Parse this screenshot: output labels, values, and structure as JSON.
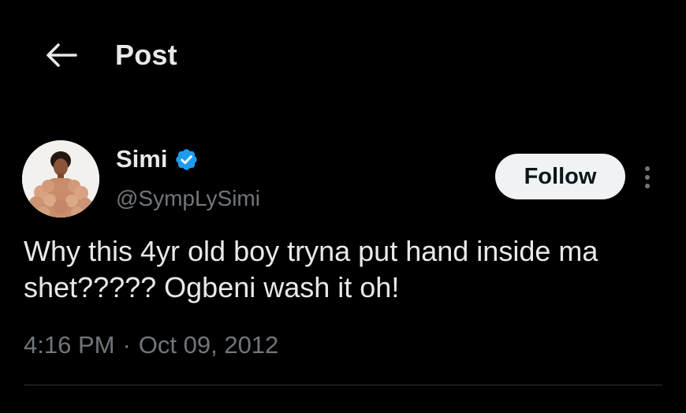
{
  "header": {
    "title": "Post",
    "back_icon": "arrow-left-icon"
  },
  "author": {
    "name": "Simi",
    "handle": "@SympLySimi",
    "verified": true,
    "verified_color": "#1d9bf0",
    "avatar_icon": "profile-photo"
  },
  "actions": {
    "follow_label": "Follow",
    "more_icon": "more-vertical-icon"
  },
  "post": {
    "text": "Why this 4yr old boy tryna put hand inside ma shet????? Ogbeni wash it oh!",
    "time": "4:16 PM",
    "separator": "·",
    "date": "Oct 09, 2012"
  },
  "colors": {
    "background": "#000000",
    "primary_text": "#e7e9ea",
    "secondary_text": "#71767b",
    "follow_bg": "#eff3f4",
    "divider": "#2f3336"
  }
}
